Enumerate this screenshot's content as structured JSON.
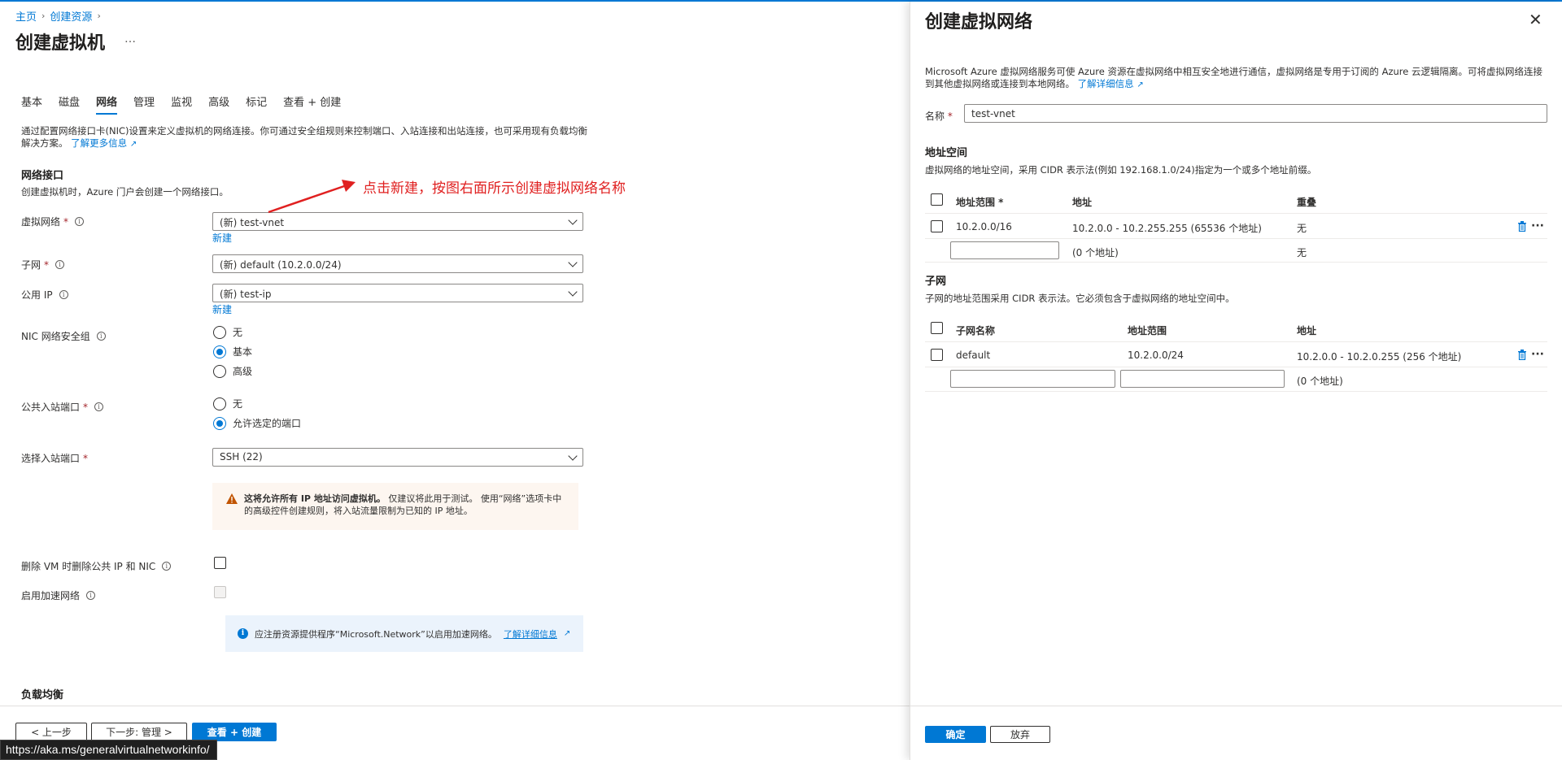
{
  "breadcrumb": {
    "home": "主页",
    "create": "创建资源"
  },
  "page": {
    "title": "创建虚拟机",
    "more": "…"
  },
  "tabs": [
    "基本",
    "磁盘",
    "网络",
    "管理",
    "监视",
    "高级",
    "标记",
    "查看 + 创建"
  ],
  "intro": {
    "text": "通过配置网络接口卡(NIC)设置来定义虚拟机的网络连接。你可通过安全组规则来控制端口、入站连接和出站连接，也可采用现有负载均衡解决方案。",
    "learn_more": "了解更多信息"
  },
  "network_interface": {
    "heading": "网络接口",
    "subtitle": "创建虚拟机时，Azure 门户会创建一个网络接口。",
    "vnet_label": "虚拟网络",
    "vnet_value": "(新) test-vnet",
    "vnet_new": "新建",
    "subnet_label": "子网",
    "subnet_value": "(新) default (10.2.0.0/24)",
    "public_ip_label": "公用 IP",
    "public_ip_value": "(新) test-ip",
    "public_ip_new": "新建",
    "nsg_label": "NIC 网络安全组",
    "nsg_options": [
      "无",
      "基本",
      "高级"
    ],
    "nsg_selected": "基本",
    "inbound_label": "公共入站端口",
    "inbound_options": [
      "无",
      "允许选定的端口"
    ],
    "inbound_selected": "允许选定的端口",
    "select_port_label": "选择入站端口",
    "select_port_value": "SSH (22)",
    "warning_bold": "这将允许所有 IP 地址访问虚拟机。",
    "warning_rest": " 仅建议将此用于测试。 使用“网络”选项卡中的高级控件创建规则，将入站流量限制为已知的 IP 地址。",
    "delete_label": "删除 VM 时删除公共 IP 和 NIC",
    "accel_label": "启用加速网络",
    "accel_info": "应注册资源提供程序“Microsoft.Network”以启用加速网络。",
    "accel_link": "了解详细信息"
  },
  "load_balancing": {
    "heading": "负载均衡"
  },
  "footer": {
    "prev": "< 上一步",
    "next": "下一步: 管理 >",
    "review": "查看 + 创建"
  },
  "status_url": "https://aka.ms/generalvirtualnetworkinfo/",
  "annotation": "点击新建，按图右面所示创建虚拟网络名称",
  "panel": {
    "title": "创建虚拟网络",
    "desc": "Microsoft Azure 虚拟网络服务可使 Azure 资源在虚拟网络中相互安全地进行通信，虚拟网络是专用于订阅的 Azure 云逻辑隔离。可将虚拟网络连接到其他虚拟网络或连接到本地网络。",
    "desc_link": "了解详细信息",
    "name_label": "名称",
    "name_value": "test-vnet",
    "address_space": {
      "heading": "地址空间",
      "subtitle": "虚拟网络的地址空间，采用 CIDR 表示法(例如 192.168.1.0/24)指定为一个或多个地址前缀。",
      "headers": [
        "地址范围 *",
        "地址",
        "重叠"
      ],
      "rows": [
        {
          "range": "10.2.0.0/16",
          "address": "10.2.0.0 - 10.2.255.255 (65536 个地址)",
          "overlap": "无"
        }
      ],
      "empty_row": {
        "address": "(0 个地址)",
        "overlap": "无"
      }
    },
    "subnet": {
      "heading": "子网",
      "subtitle": "子网的地址范围采用 CIDR 表示法。它必须包含于虚拟网络的地址空间中。",
      "headers": [
        "子网名称",
        "地址范围",
        "地址"
      ],
      "rows": [
        {
          "name": "default",
          "range": "10.2.0.0/24",
          "address": "10.2.0.0 - 10.2.0.255 (256 个地址)"
        }
      ],
      "empty_row": {
        "address": "(0 个地址)"
      }
    },
    "ok": "确定",
    "discard": "放弃"
  },
  "colors": {
    "accent": "#0078d4",
    "required": "#a4262c",
    "annotation": "#e02020",
    "warning": "#c15400"
  }
}
